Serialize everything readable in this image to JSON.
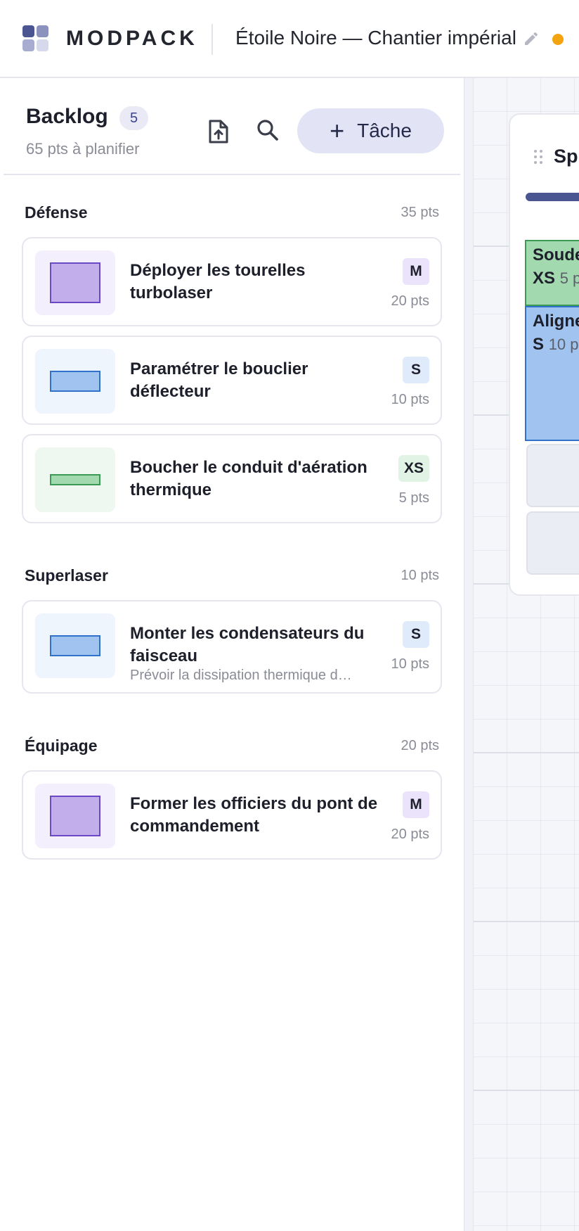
{
  "header": {
    "brand": "MODPACK",
    "project_title": "Étoile Noire — Chantier impérial",
    "status_color": "#f2a30f"
  },
  "backlog": {
    "title": "Backlog",
    "count": "5",
    "subtitle": "65 pts à planifier",
    "add_task_label": "Tâche",
    "groups": [
      {
        "name": "Défense",
        "points": "35 pts",
        "tasks": [
          {
            "title": "Déployer les tourelles turbolaser",
            "size": "M",
            "points": "20 pts",
            "icon": "task-size-m"
          },
          {
            "title": "Paramétrer le bouclier déflecteur",
            "size": "S",
            "points": "10 pts",
            "icon": "task-size-s"
          },
          {
            "title": "Boucher le conduit d'aération thermique",
            "size": "XS",
            "points": "5 pts",
            "icon": "task-size-xs"
          }
        ]
      },
      {
        "name": "Superlaser",
        "points": "10 pts",
        "tasks": [
          {
            "title": "Monter les condensateurs du faisceau",
            "description": "Prévoir la dissipation thermique d…",
            "size": "S",
            "points": "10 pts",
            "icon": "task-size-s"
          }
        ]
      },
      {
        "name": "Équipage",
        "points": "20 pts",
        "tasks": [
          {
            "title": "Former les officiers du pont de commandement",
            "size": "M",
            "points": "20 pts",
            "icon": "task-size-m"
          }
        ]
      }
    ]
  },
  "sprint": {
    "name": "Sp",
    "tasks": [
      {
        "title": "Soude",
        "size": "XS",
        "points": "5 p"
      },
      {
        "title": "Aligne",
        "size": "S",
        "points": "10 p"
      }
    ]
  },
  "colors": {
    "accent": "#4b5591",
    "size_m": "#c3aeec",
    "size_s": "#a0c3ef",
    "size_xs": "#a3d9ae"
  }
}
